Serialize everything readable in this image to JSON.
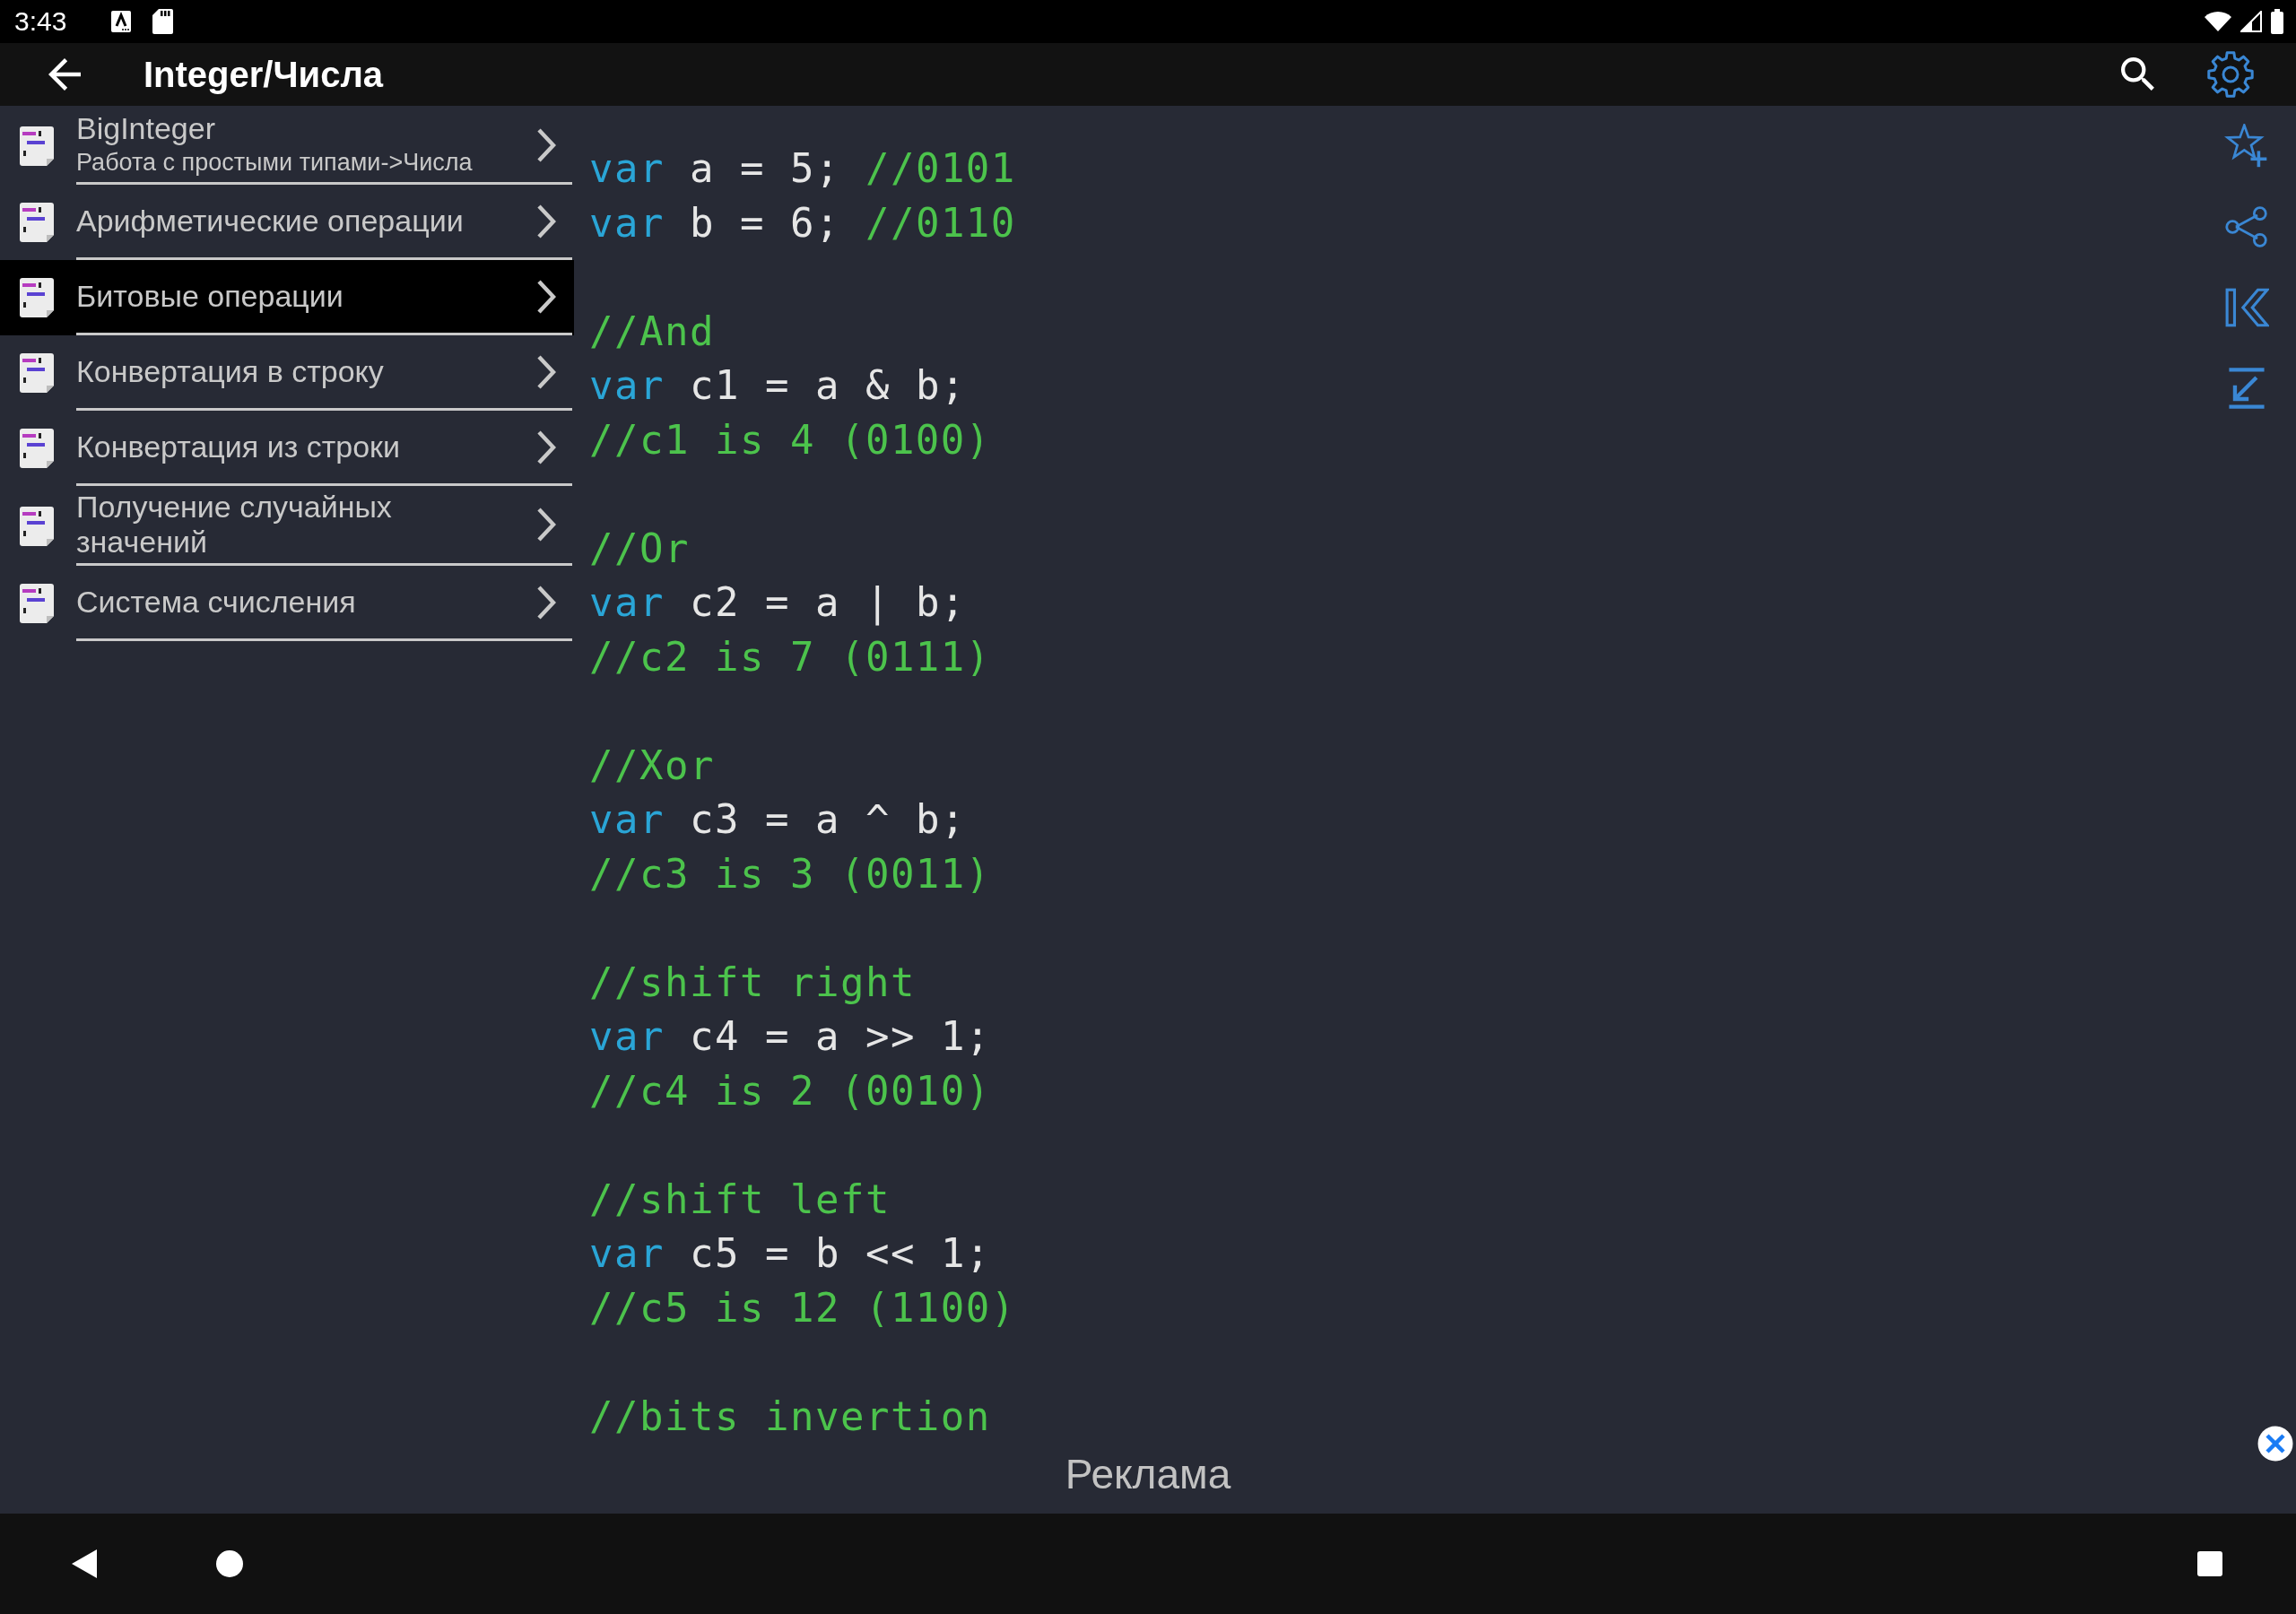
{
  "status_bar": {
    "time": "3:43"
  },
  "app_bar": {
    "title": "Integer/Числа"
  },
  "sidebar": {
    "items": [
      {
        "title": "BigInteger",
        "subtitle": "Работа с простыми типами->Числа",
        "selected": false
      },
      {
        "title": "Арифметические операции",
        "selected": false
      },
      {
        "title": "Битовые операции",
        "selected": true
      },
      {
        "title": "Конвертация в строку",
        "selected": false
      },
      {
        "title": "Конвертация из строки",
        "selected": false
      },
      {
        "title": "Получение случайных значений",
        "selected": false
      },
      {
        "title": "Система счисления",
        "selected": false
      }
    ]
  },
  "code": {
    "blocks": [
      [
        [
          {
            "kind": "keyword",
            "text": "var"
          },
          {
            "kind": "text",
            "text": " a = 5; "
          },
          {
            "kind": "comment",
            "text": "//0101"
          }
        ],
        [
          {
            "kind": "keyword",
            "text": "var"
          },
          {
            "kind": "text",
            "text": " b = 6; "
          },
          {
            "kind": "comment",
            "text": "//0110"
          }
        ]
      ],
      [
        [
          {
            "kind": "comment",
            "text": "//And"
          }
        ],
        [
          {
            "kind": "keyword",
            "text": "var"
          },
          {
            "kind": "text",
            "text": " c1 = a & b;"
          }
        ],
        [
          {
            "kind": "comment",
            "text": "//c1 is 4 (0100)"
          }
        ]
      ],
      [
        [
          {
            "kind": "comment",
            "text": "//Or"
          }
        ],
        [
          {
            "kind": "keyword",
            "text": "var"
          },
          {
            "kind": "text",
            "text": " c2 = a | b;"
          }
        ],
        [
          {
            "kind": "comment",
            "text": "//c2 is 7 (0111)"
          }
        ]
      ],
      [
        [
          {
            "kind": "comment",
            "text": "//Xor"
          }
        ],
        [
          {
            "kind": "keyword",
            "text": "var"
          },
          {
            "kind": "text",
            "text": " c3 = a ^ b;"
          }
        ],
        [
          {
            "kind": "comment",
            "text": "//c3 is 3 (0011)"
          }
        ]
      ],
      [
        [
          {
            "kind": "comment",
            "text": "//shift right"
          }
        ],
        [
          {
            "kind": "keyword",
            "text": "var"
          },
          {
            "kind": "text",
            "text": " c4 = a >> 1;"
          }
        ],
        [
          {
            "kind": "comment",
            "text": "//c4 is 2 (0010)"
          }
        ]
      ],
      [
        [
          {
            "kind": "comment",
            "text": "//shift left"
          }
        ],
        [
          {
            "kind": "keyword",
            "text": "var"
          },
          {
            "kind": "text",
            "text": " c5 = b << 1;"
          }
        ],
        [
          {
            "kind": "comment",
            "text": "//c5 is 12 (1100)"
          }
        ]
      ],
      [
        [
          {
            "kind": "comment",
            "text": "//bits invertion"
          }
        ]
      ]
    ]
  },
  "ad": {
    "label": "Реклама"
  }
}
